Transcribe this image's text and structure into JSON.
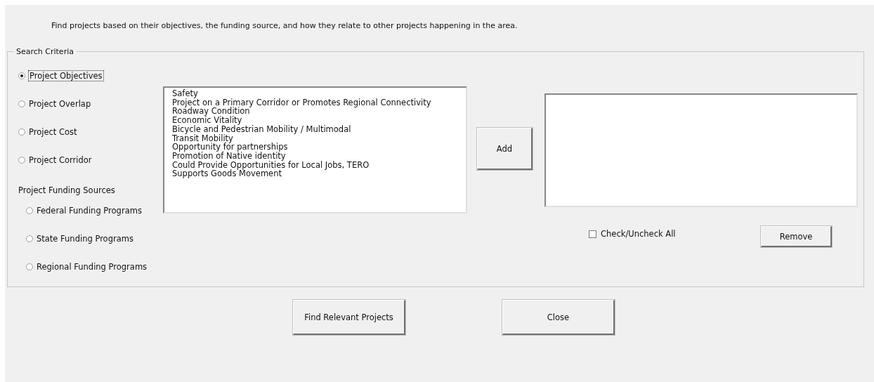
{
  "description": "Find projects based on their objectives, the funding source, and how they relate to other projects happening in the area.",
  "search_criteria": {
    "legend": "Search Criteria",
    "options": [
      {
        "label": "Project Objectives",
        "selected": true
      },
      {
        "label": "Project Overlap",
        "selected": false
      },
      {
        "label": "Project Cost",
        "selected": false
      },
      {
        "label": "Project Corridor",
        "selected": false
      }
    ],
    "funding_label": "Project Funding Sources",
    "funding_options": [
      {
        "label": "Federal Funding Programs",
        "selected": false
      },
      {
        "label": "State Funding Programs",
        "selected": false
      },
      {
        "label": "Regional Funding Programs",
        "selected": false
      }
    ]
  },
  "objectives_list": [
    "Safety",
    "Project on a Primary Corridor or Promotes Regional Connectivity",
    "Roadway Condition",
    "Economic Vitality",
    "Bicycle and Pedestrian Mobility / Multimodal",
    "Transit Mobility",
    "Opportunity for partnerships",
    "Promotion of Native identity",
    "Could Provide Opportunities for Local Jobs, TERO",
    "Supports Goods Movement"
  ],
  "add_button": "Add",
  "check_all": {
    "label": "Check/Uncheck All",
    "checked": false
  },
  "remove_button": "Remove",
  "buttons": [
    "Find Relevant Projects",
    "Close"
  ]
}
